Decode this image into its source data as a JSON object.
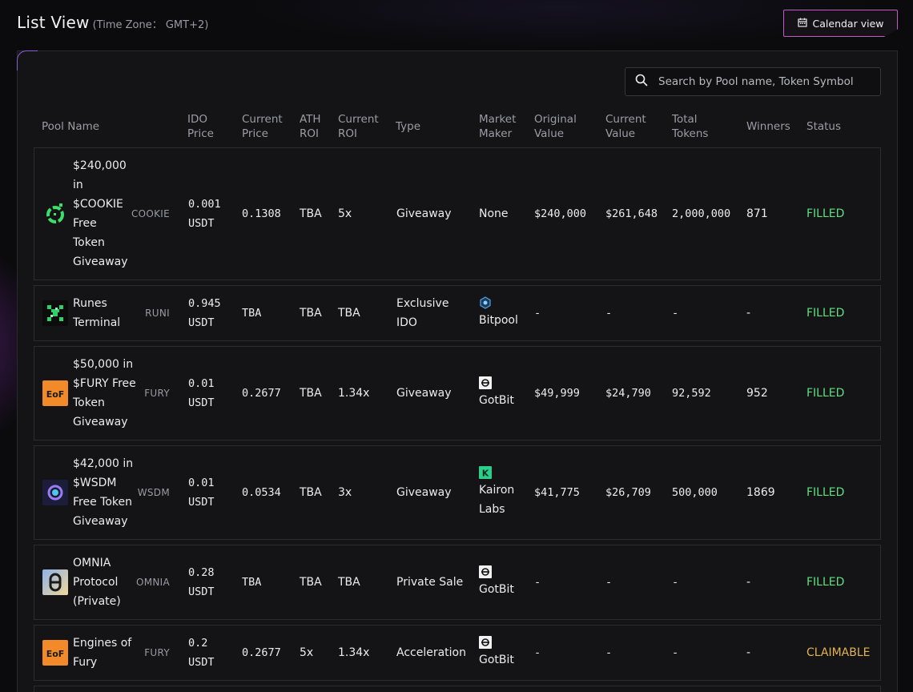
{
  "header": {
    "title": "List View",
    "timezone": "(Time Zone： GMT+2)"
  },
  "calendar_button": {
    "label": "Calendar view"
  },
  "search": {
    "placeholder": "Search by Pool name, Token Symbol"
  },
  "columns": {
    "pool_name": "Pool Name",
    "ido_price": "IDO\nPrice",
    "current_price": "Current\nPrice",
    "ath_roi": "ATH\nROI",
    "current_roi": "Current\nROI",
    "type": "Type",
    "market_maker": "Market\nMaker",
    "original_value": "Original\nValue",
    "current_value": "Current\nValue",
    "total_tokens": "Total\nTokens",
    "winners": "Winners",
    "status": "Status"
  },
  "colors": {
    "filled": "#5ee07f",
    "claimable": "#e3b34d",
    "accent": "#c25ac7"
  },
  "rows": [
    {
      "name": "$240,000\nin\n$COOKIE\nFree\nToken\nGiveaway",
      "symbol": "COOKIE",
      "ido_price": "0.001\nUSDT",
      "current_price": "0.1308",
      "ath_roi": "TBA",
      "current_roi": "5x",
      "type": "Giveaway",
      "market_maker": "None",
      "mm_icon": "",
      "original_value": "$240,000",
      "current_value": "$261,648",
      "total_tokens": "2,000,000",
      "winners": "871",
      "status": "FILLED",
      "logo": "cookie-logo"
    },
    {
      "name": "Runes\nTerminal",
      "symbol": "RUNI",
      "ido_price": "0.945\nUSDT",
      "current_price": "TBA",
      "ath_roi": "TBA",
      "current_roi": "TBA",
      "type": "Exclusive\nIDO",
      "market_maker": "Bitpool",
      "mm_icon": "bitpool-icon",
      "original_value": "-",
      "current_value": "-",
      "total_tokens": "-",
      "winners": "-",
      "status": "FILLED",
      "logo": "runes-logo"
    },
    {
      "name": "$50,000 in\n$FURY Free\nToken\nGiveaway",
      "symbol": "FURY",
      "ido_price": "0.01\nUSDT",
      "current_price": "0.2677",
      "ath_roi": "TBA",
      "current_roi": "1.34x",
      "type": "Giveaway",
      "market_maker": "GotBit",
      "mm_icon": "gotbit-icon",
      "original_value": "$49,999",
      "current_value": "$24,790",
      "total_tokens": "92,592",
      "winners": "952",
      "status": "FILLED",
      "logo": "fury-logo"
    },
    {
      "name": "$42,000 in\n$WSDM\nFree Token\nGiveaway",
      "symbol": "WSDM",
      "ido_price": "0.01\nUSDT",
      "current_price": "0.0534",
      "ath_roi": "TBA",
      "current_roi": "3x",
      "type": "Giveaway",
      "market_maker": "Kairon\nLabs",
      "mm_icon": "kairon-icon",
      "original_value": "$41,775",
      "current_value": "$26,709",
      "total_tokens": "500,000",
      "winners": "1869",
      "status": "FILLED",
      "logo": "wsdm-logo"
    },
    {
      "name": "OMNIA\nProtocol\n(Private)",
      "symbol": "OMNIA",
      "ido_price": "0.28\nUSDT",
      "current_price": "TBA",
      "ath_roi": "TBA",
      "current_roi": "TBA",
      "type": "Private Sale",
      "market_maker": "GotBit",
      "mm_icon": "gotbit-icon",
      "original_value": "-",
      "current_value": "-",
      "total_tokens": "-",
      "winners": "-",
      "status": "FILLED",
      "logo": "omnia-logo"
    },
    {
      "name": "Engines of\nFury",
      "symbol": "FURY",
      "ido_price": "0.2\nUSDT",
      "current_price": "0.2677",
      "ath_roi": "5x",
      "current_roi": "1.34x",
      "type": "Acceleration",
      "market_maker": "GotBit",
      "mm_icon": "gotbit-icon",
      "original_value": "-",
      "current_value": "-",
      "total_tokens": "-",
      "winners": "-",
      "status": "CLAIMABLE",
      "logo": "fury-logo"
    }
  ]
}
